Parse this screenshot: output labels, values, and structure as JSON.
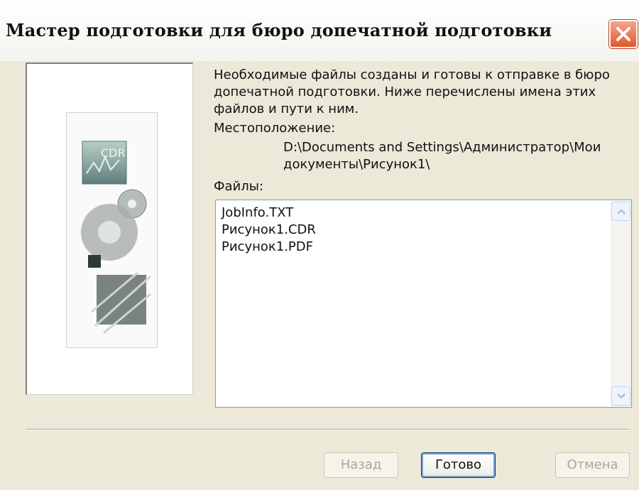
{
  "window": {
    "title": "Мастер подготовки для бюро допечатной подготовки"
  },
  "content": {
    "description": "Необходимые файлы созданы и готовы к отправке в бюро допечатной подготовки. Ниже перечислены имена этих файлов и пути к ним.",
    "location_label": "Местоположение:",
    "location_path": "D:\\Documents and Settings\\Администратор\\Мои документы\\Рисунок1\\",
    "files_label": "Файлы:",
    "files": [
      "JobInfo.TXT",
      "Рисунок1.CDR",
      "Рисунок1.PDF"
    ]
  },
  "illustration": {
    "badge_text": "CDR"
  },
  "buttons": {
    "back": "Назад",
    "finish": "Готово",
    "cancel": "Отмена"
  },
  "icons": {
    "close": "close-icon",
    "scroll_up": "arrow-up-icon",
    "scroll_down": "arrow-down-icon"
  },
  "colors": {
    "dialog_bg": "#ece9d8",
    "close_button": "#e0582d",
    "list_border": "#7f9db9"
  }
}
